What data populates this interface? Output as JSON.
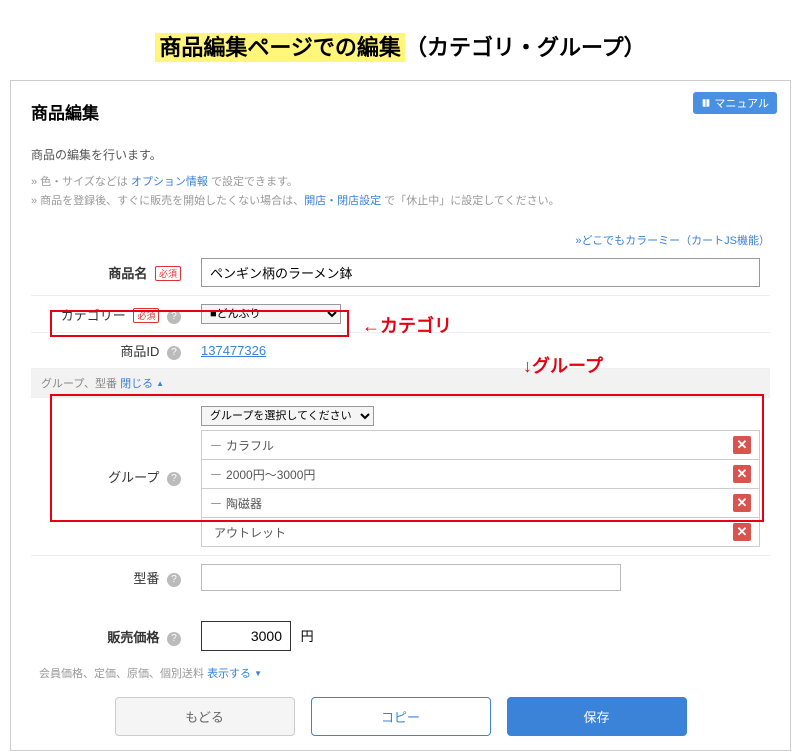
{
  "page_title_main": "商品編集ページでの編集",
  "page_title_sub": "（カテゴリ・グループ）",
  "manual_button": "マニュアル",
  "section_heading": "商品編集",
  "lead_text": "商品の編集を行います。",
  "note1_prefix": "» 色・サイズなどは ",
  "note1_link": "オプション情報",
  "note1_suffix": " で設定できます。",
  "note2_prefix": "» 商品を登録後、すぐに販売を開始したくない場合は、",
  "note2_link": "開店・閉店設定",
  "note2_suffix": " で「休止中」に設定してください。",
  "topright_link": "»どこでもカラーミー（カートJS機能）",
  "labels": {
    "product_name": "商品名",
    "category": "カテゴリー",
    "product_id": "商品ID",
    "group": "グループ",
    "model": "型番",
    "price": "販売価格",
    "required": "必須"
  },
  "values": {
    "product_name": "ペンギン柄のラーメン鉢",
    "category_option": "■どんぶり",
    "product_id": "137477326",
    "group_select": "グループを選択してください",
    "model": "",
    "price": "3000",
    "price_unit": "円"
  },
  "group_items": [
    {
      "prefix": "ー",
      "label": "カラフル"
    },
    {
      "prefix": "ー",
      "label": "2000円～3000円"
    },
    {
      "prefix": "ー",
      "label": "陶磁器"
    },
    {
      "prefix": "",
      "label": "アウトレット"
    }
  ],
  "accordion": {
    "label_prefix": "グループ、型番 ",
    "close_link": "閉じる"
  },
  "footer_expand": {
    "prefix": "会員価格、定価、原価、個別送料 ",
    "link": "表示する"
  },
  "buttons": {
    "back": "もどる",
    "copy": "コピー",
    "save": "保存"
  },
  "annotations": {
    "category": "←カテゴリ",
    "group": "↓グループ"
  }
}
